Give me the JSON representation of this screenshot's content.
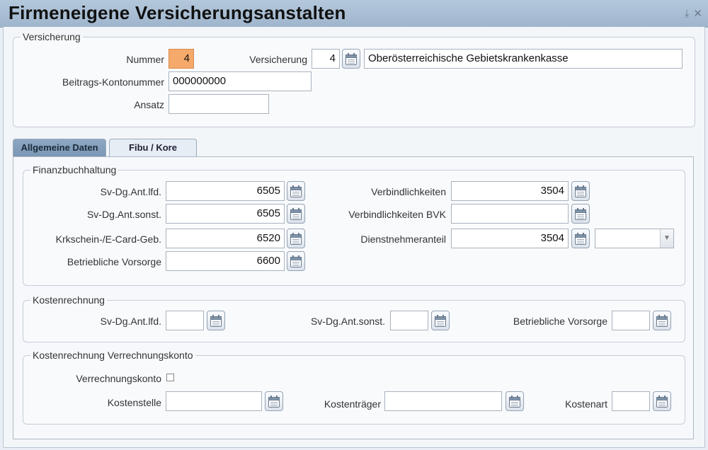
{
  "window": {
    "title": "Firmeneigene Versicherungsanstalten",
    "controls": {
      "pin": "⤓",
      "close": "✕"
    }
  },
  "versicherung": {
    "legend": "Versicherung",
    "nummer_label": "Nummer",
    "nummer_value": "4",
    "versicherung_label": "Versicherung",
    "versicherung_code": "4",
    "versicherung_name": "Oberösterreichische Gebietskrankenkasse",
    "beitrags_label": "Beitrags-Kontonummer",
    "beitrags_value": "000000000",
    "ansatz_label": "Ansatz",
    "ansatz_value": ""
  },
  "tabs": [
    {
      "label": "Allgemeine Daten",
      "active": true
    },
    {
      "label": "Fibu / Kore",
      "active": false
    }
  ],
  "finanz": {
    "legend": "Finanzbuchhaltung",
    "left": [
      {
        "label": "Sv-Dg.Ant.lfd.",
        "value": "6505"
      },
      {
        "label": "Sv-Dg.Ant.sonst.",
        "value": "6505"
      },
      {
        "label": "Krkschein-/E-Card-Geb.",
        "value": "6520"
      },
      {
        "label": "Betriebliche Vorsorge",
        "value": "6600"
      }
    ],
    "right": [
      {
        "label": "Verbindlichkeiten",
        "value": "3504"
      },
      {
        "label": "Verbindlichkeiten BVK",
        "value": ""
      },
      {
        "label": "Dienstnehmeranteil",
        "value": "3504"
      }
    ],
    "dropdown_value": ""
  },
  "kosten": {
    "legend": "Kostenrechnung",
    "fields": [
      {
        "label": "Sv-Dg.Ant.lfd.",
        "value": ""
      },
      {
        "label": "Sv-Dg.Ant.sonst.",
        "value": ""
      },
      {
        "label": "Betriebliche Vorsorge",
        "value": ""
      }
    ]
  },
  "verrechnung": {
    "legend": "Kostenrechnung Verrechnungskonto",
    "checkbox_label": "Verrechnungskonto",
    "checked": false,
    "fields": [
      {
        "label": "Kostenstelle",
        "value": ""
      },
      {
        "label": "Kostenträger",
        "value": ""
      },
      {
        "label": "Kostenart",
        "value": ""
      }
    ]
  },
  "colors": {
    "highlight_field": "#f5a96a",
    "active_tab": "#8ea8c3",
    "titlebar": "#a8bdd2"
  },
  "icons": {
    "lookup": "calendar-lookup-icon"
  }
}
